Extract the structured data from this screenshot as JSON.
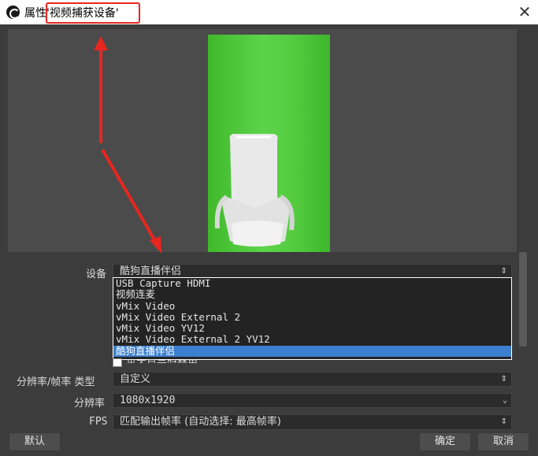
{
  "window": {
    "title_prefix": "属性",
    "title_source": "'视频捕获设备'",
    "close_glyph": "✕"
  },
  "annotations": {
    "highlight_color": "#e8261f",
    "arrow_color": "#e8261f"
  },
  "form": {
    "device_label": "设备",
    "device_value": "酷狗直播伴侣",
    "device_options": [
      "USB Capture HDMI",
      "视频连麦",
      "vMix Video",
      "vMix Video External 2",
      "vMix Video YV12",
      "vMix Video External 2 YV12",
      "酷狗直播伴侣"
    ],
    "hidden_checkbox_label": "当不显示时禁用",
    "res_type_label": "分辨率/帧率 类型",
    "res_type_value": "自定义",
    "resolution_label": "分辨率",
    "resolution_value": "1080x1920",
    "fps_label": "FPS",
    "fps_value": "匹配输出帧率 (自动选择: 最高帧率)"
  },
  "buttons": {
    "defaults": "默认",
    "ok": "确定",
    "cancel": "取消"
  },
  "colors": {
    "accent_selected": "#3c7fce",
    "chroma_green": "#4fc63a"
  }
}
